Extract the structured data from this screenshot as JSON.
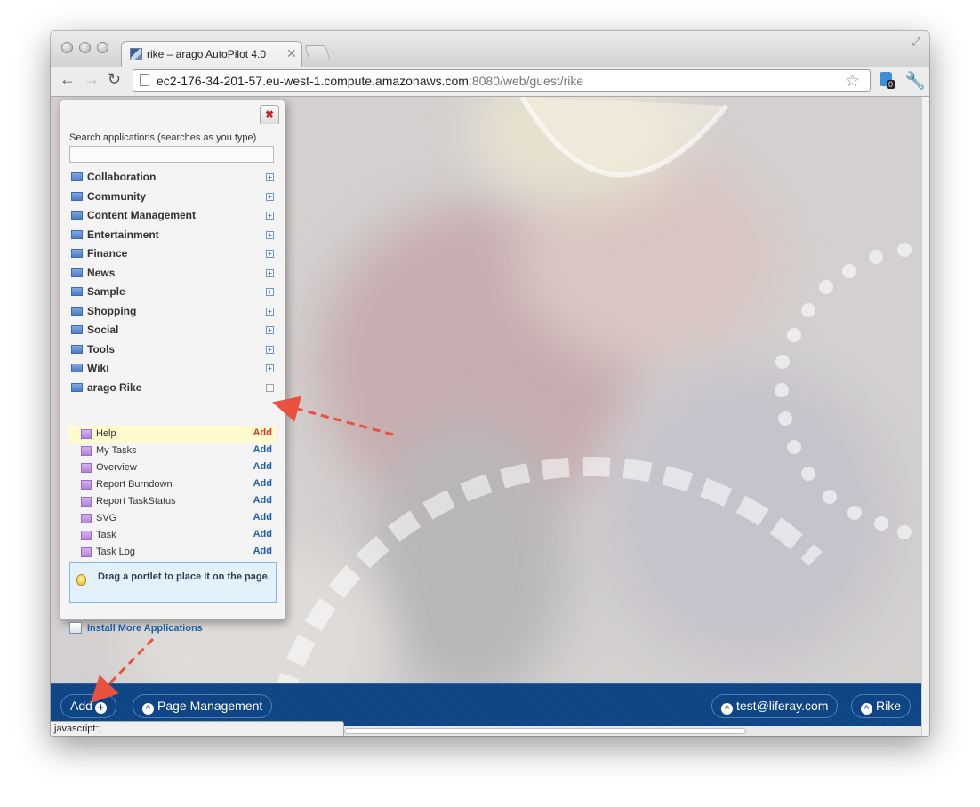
{
  "browser": {
    "tab_title": "rike – arago AutoPilot 4.0",
    "tab_close": "✕",
    "url_host": "ec2-176-34-201-57.eu-west-1.compute.amazonaws.com",
    "url_rest": ":8080/web/guest/rike",
    "extension_badge": "0",
    "status_text": "javascript:;"
  },
  "panel": {
    "close_symbol": "✖",
    "search_label": "Search applications (searches as you type).",
    "search_value": "",
    "categories": [
      {
        "label": "Collaboration",
        "expand": "+"
      },
      {
        "label": "Community",
        "expand": "+"
      },
      {
        "label": "Content Management",
        "expand": "+"
      },
      {
        "label": "Entertainment",
        "expand": "+"
      },
      {
        "label": "Finance",
        "expand": "+"
      },
      {
        "label": "News",
        "expand": "+"
      },
      {
        "label": "Sample",
        "expand": "+"
      },
      {
        "label": "Shopping",
        "expand": "+"
      },
      {
        "label": "Social",
        "expand": "+"
      },
      {
        "label": "Tools",
        "expand": "+"
      },
      {
        "label": "Wiki",
        "expand": "+"
      },
      {
        "label": "arago Rike",
        "expand": "−"
      }
    ],
    "apps": [
      {
        "label": "Help",
        "action": "Add"
      },
      {
        "label": "My Tasks",
        "action": "Add"
      },
      {
        "label": "Overview",
        "action": "Add"
      },
      {
        "label": "Report Burndown",
        "action": "Add"
      },
      {
        "label": "Report TaskStatus",
        "action": "Add"
      },
      {
        "label": "SVG",
        "action": "Add"
      },
      {
        "label": "Task",
        "action": "Add"
      },
      {
        "label": "Task Log",
        "action": "Add"
      }
    ],
    "tip": "Drag a portlet to place it on the page.",
    "install_link": "Install More Applications"
  },
  "dockbar": {
    "add_label": "Add",
    "plus_symbol": "+",
    "page_management_label": "Page Management",
    "user_label": "test@liferay.com",
    "site_label": "Rike",
    "arrow_symbol": "^"
  },
  "colors": {
    "dockbar": "#104a8a",
    "add_link": "#1f5ea8",
    "highlight_add": "#d9362c",
    "annotation_arrow": "#e8523f"
  }
}
